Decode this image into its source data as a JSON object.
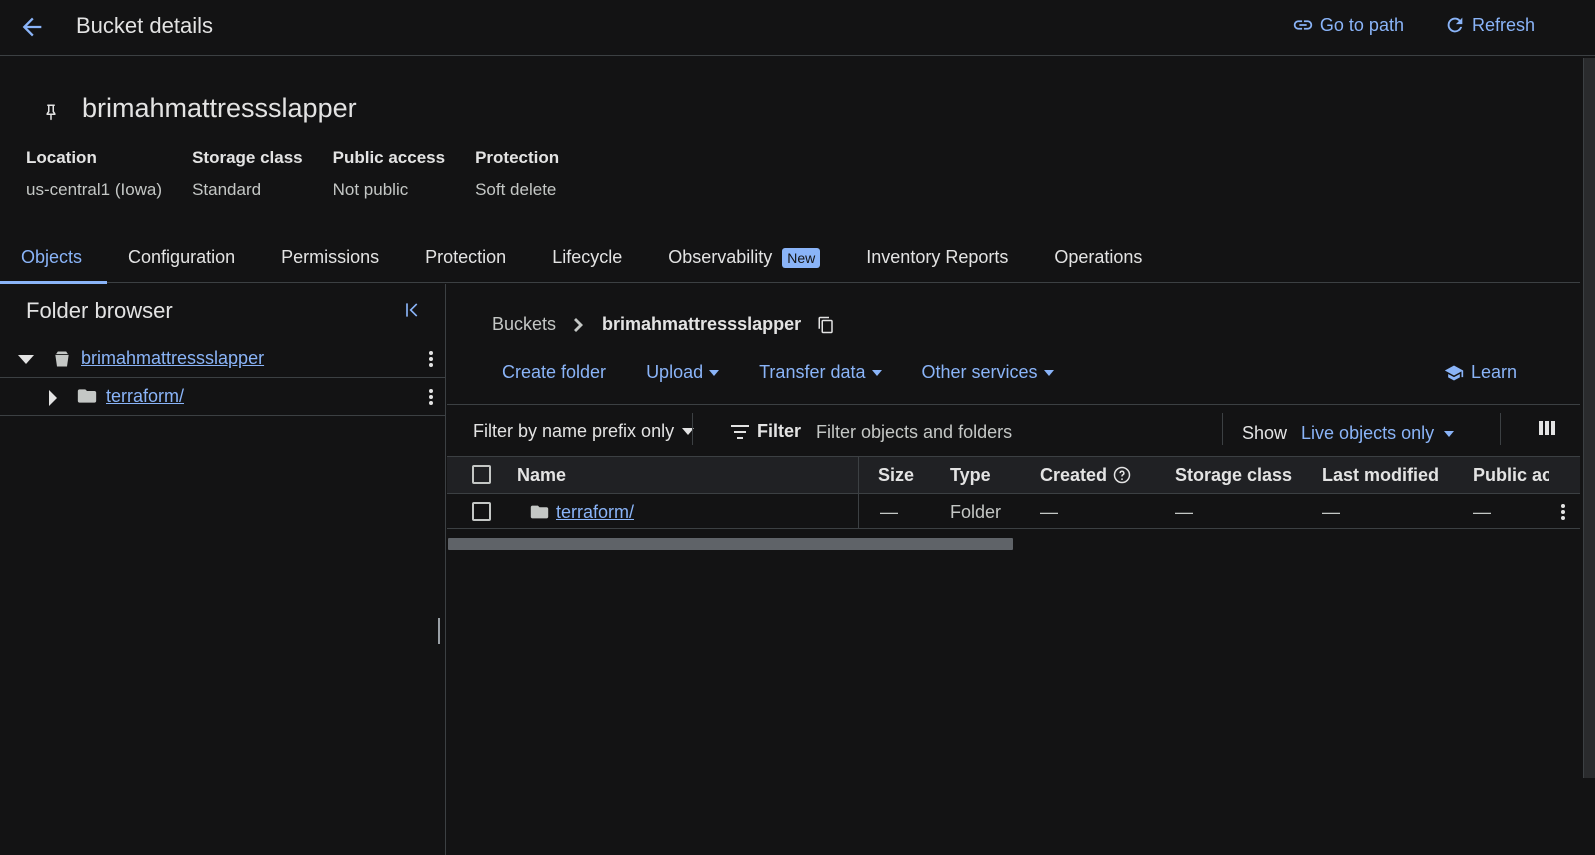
{
  "header": {
    "title": "Bucket details",
    "go_to_path": "Go to path",
    "refresh": "Refresh"
  },
  "bucket": {
    "name": "brimahmattressslapper",
    "meta": [
      {
        "label": "Location",
        "value": "us-central1 (Iowa)"
      },
      {
        "label": "Storage class",
        "value": "Standard"
      },
      {
        "label": "Public access",
        "value": "Not public"
      },
      {
        "label": "Protection",
        "value": "Soft delete"
      }
    ]
  },
  "tabs": [
    {
      "label": "Objects",
      "active": true
    },
    {
      "label": "Configuration"
    },
    {
      "label": "Permissions"
    },
    {
      "label": "Protection"
    },
    {
      "label": "Lifecycle"
    },
    {
      "label": "Observability",
      "badge": "New"
    },
    {
      "label": "Inventory Reports"
    },
    {
      "label": "Operations"
    }
  ],
  "folder_browser": {
    "title": "Folder browser",
    "root": "brimahmattressslapper",
    "child": "terraform/"
  },
  "breadcrumb": {
    "root": "Buckets",
    "current": "brimahmattressslapper"
  },
  "actions": {
    "create_folder": "Create folder",
    "upload": "Upload",
    "transfer_data": "Transfer data",
    "other_services": "Other services",
    "learn": "Learn"
  },
  "filter": {
    "prefix_mode": "Filter by name prefix only",
    "filter_label": "Filter",
    "placeholder": "Filter objects and folders",
    "show_label": "Show",
    "show_value": "Live objects only"
  },
  "table": {
    "columns": [
      "Name",
      "Size",
      "Type",
      "Created",
      "Storage class",
      "Last modified",
      "Public ac"
    ],
    "rows": [
      {
        "name": "terraform/",
        "size": "—",
        "type": "Folder",
        "created": "—",
        "storage_class": "—",
        "last_modified": "—",
        "public_access": "—"
      }
    ]
  },
  "colors": {
    "background": "#131314",
    "accent": "#8ab4f8",
    "border": "#3c4043"
  }
}
